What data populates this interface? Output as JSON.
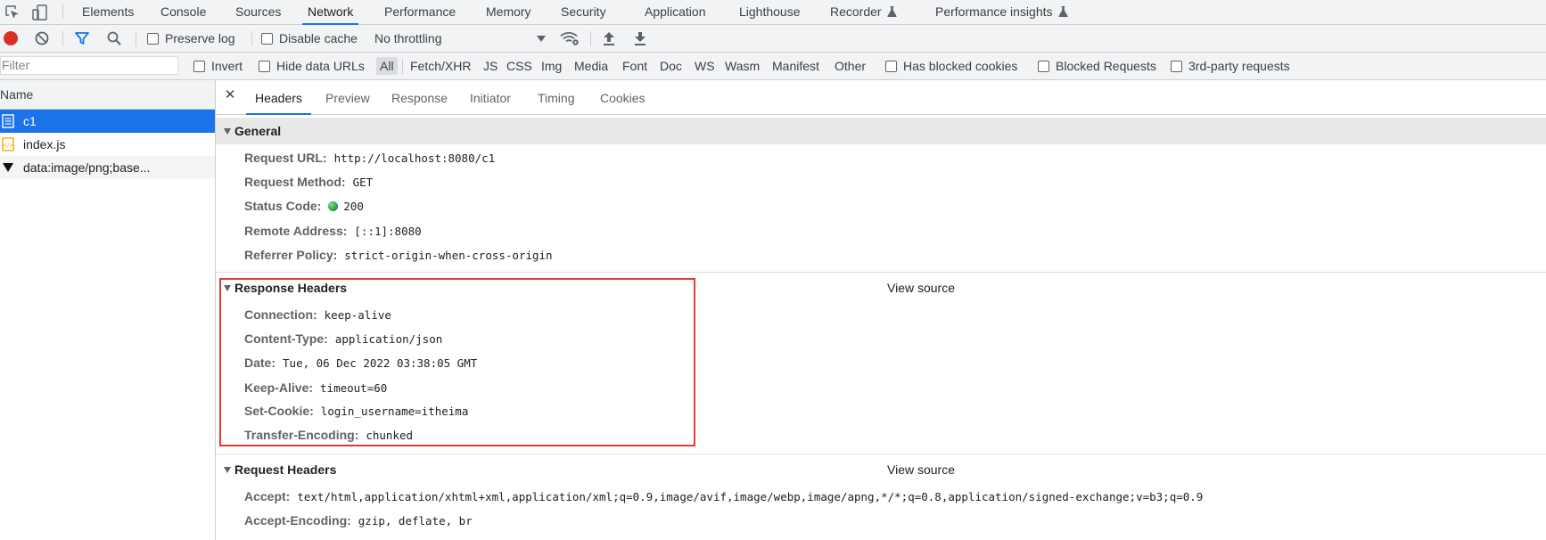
{
  "tabs": [
    {
      "label": "Elements"
    },
    {
      "label": "Console"
    },
    {
      "label": "Sources"
    },
    {
      "label": "Network"
    },
    {
      "label": "Performance"
    },
    {
      "label": "Memory"
    },
    {
      "label": "Security"
    },
    {
      "label": "Application"
    },
    {
      "label": "Lighthouse"
    },
    {
      "label": "Recorder"
    },
    {
      "label": "Performance insights"
    }
  ],
  "active_tab": "Network",
  "toolbar": {
    "preserve_log": "Preserve log",
    "disable_cache": "Disable cache",
    "throttling": "No throttling"
  },
  "filterbar": {
    "placeholder": "Filter",
    "invert": "Invert",
    "hide_data_urls": "Hide data URLs",
    "types": [
      "All",
      "Fetch/XHR",
      "JS",
      "CSS",
      "Img",
      "Media",
      "Font",
      "Doc",
      "WS",
      "Wasm",
      "Manifest",
      "Other"
    ],
    "has_blocked_cookies": "Has blocked cookies",
    "blocked_requests": "Blocked Requests",
    "third_party": "3rd-party requests"
  },
  "name_panel": {
    "header": "Name",
    "rows": [
      {
        "name": "c1",
        "icon": "document-icon",
        "selected": true
      },
      {
        "name": "index.js",
        "icon": "script-icon",
        "selected": false
      },
      {
        "name": "data:image/png;base...",
        "icon": "image-icon",
        "selected": false
      }
    ]
  },
  "detail_tabs": [
    "Headers",
    "Preview",
    "Response",
    "Initiator",
    "Timing",
    "Cookies"
  ],
  "general": {
    "title": "General",
    "rows": [
      {
        "name": "Request URL:",
        "value": "http://localhost:8080/c1"
      },
      {
        "name": "Request Method:",
        "value": "GET"
      },
      {
        "name": "Status Code:",
        "value": "200"
      },
      {
        "name": "Remote Address:",
        "value": "[::1]:8080"
      },
      {
        "name": "Referrer Policy:",
        "value": "strict-origin-when-cross-origin"
      }
    ]
  },
  "response_headers": {
    "title": "Response Headers",
    "view_source": "View source",
    "rows": [
      {
        "name": "Connection:",
        "value": "keep-alive"
      },
      {
        "name": "Content-Type:",
        "value": "application/json"
      },
      {
        "name": "Date:",
        "value": "Tue, 06 Dec 2022 03:38:05 GMT"
      },
      {
        "name": "Keep-Alive:",
        "value": "timeout=60"
      },
      {
        "name": "Set-Cookie:",
        "value": "login_username=itheima"
      },
      {
        "name": "Transfer-Encoding:",
        "value": "chunked"
      }
    ]
  },
  "request_headers": {
    "title": "Request Headers",
    "view_source": "View source",
    "rows": [
      {
        "name": "Accept:",
        "value": "text/html,application/xhtml+xml,application/xml;q=0.9,image/avif,image/webp,image/apng,*/*;q=0.8,application/signed-exchange;v=b3;q=0.9"
      },
      {
        "name": "Accept-Encoding:",
        "value": "gzip, deflate, br"
      }
    ]
  },
  "colors": {
    "accent": "#1a73e8",
    "highlight_box": "#e53935",
    "status_ok": "#1e8e3e",
    "record": "#d93025"
  }
}
